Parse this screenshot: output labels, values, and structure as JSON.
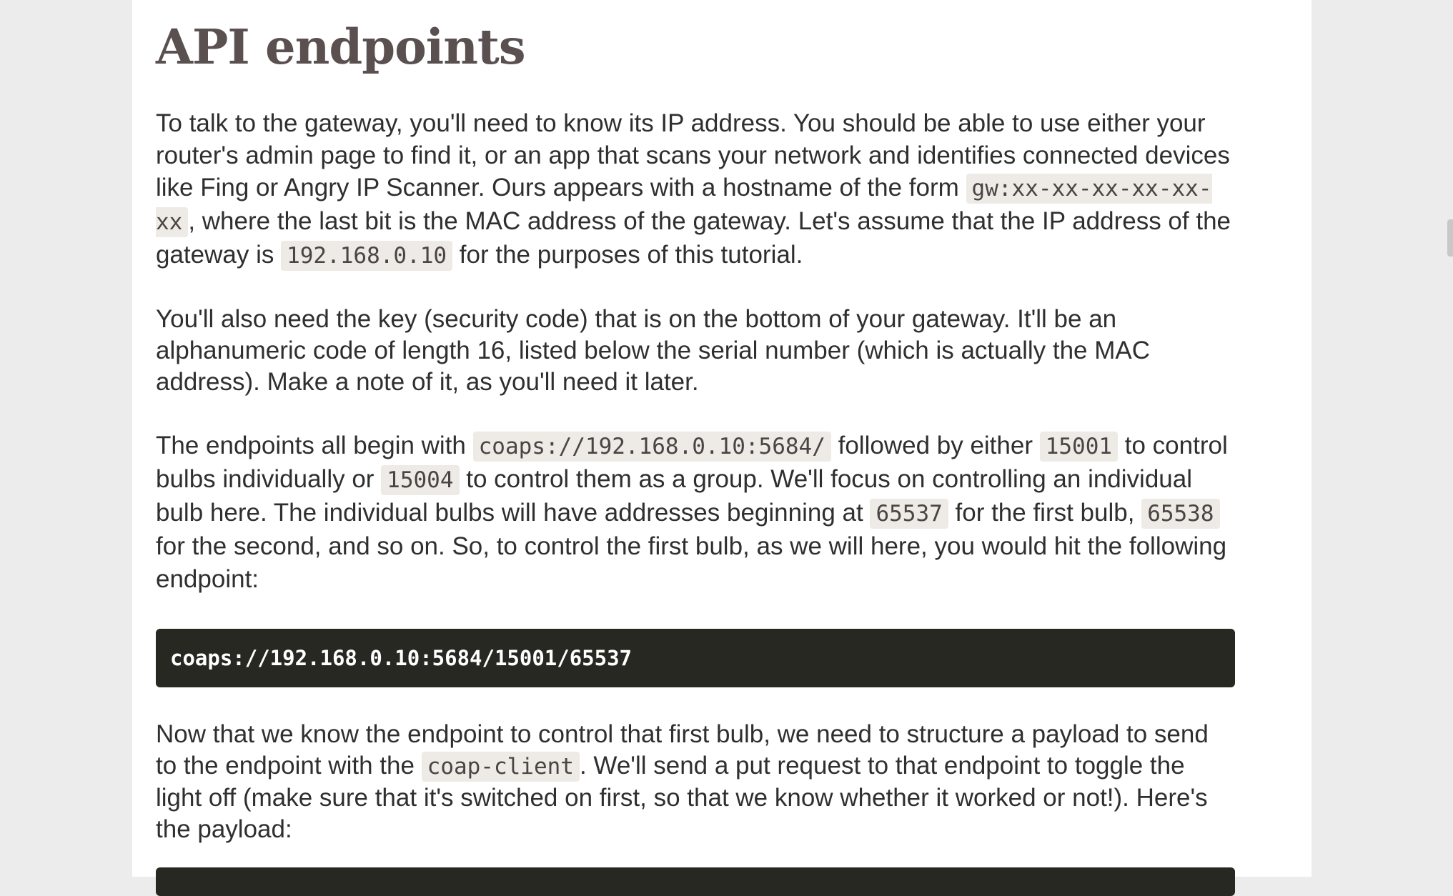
{
  "heading": "API endpoints",
  "p1": {
    "t1": "To talk to the gateway, you'll need to know its IP address. You should be able to use either your router's admin page to find it, or an app that scans your network and identifies connected devices like Fing or Angry IP Scanner. Ours appears with a hostname of the form ",
    "c1": "gw:xx-xx-xx-xx-xx-xx",
    "t2": ", where the last bit is the MAC address of the gateway. Let's assume that the IP address of the gateway is ",
    "c2": "192.168.0.10",
    "t3": " for the purposes of this tutorial."
  },
  "p2": {
    "text": "You'll also need the key (security code) that is on the bottom of your gateway. It'll be an alphanumeric code of length 16, listed below the serial number (which is actually the MAC address). Make a note of it, as you'll need it later."
  },
  "p3": {
    "t1": "The endpoints all begin with ",
    "c1": "coaps://192.168.0.10:5684/",
    "t2": " followed by either ",
    "c2": "15001",
    "t3": " to control bulbs individually or ",
    "c3": "15004",
    "t4": " to control them as a group. We'll focus on controlling an individual bulb here. The individual bulbs will have addresses beginning at ",
    "c4": "65537",
    "t5": " for the first bulb, ",
    "c5": "65538",
    "t6": " for the second, and so on. So, to control the first bulb, as we will here, you would hit the following endpoint:"
  },
  "code_block": "coaps://192.168.0.10:5684/15001/65537",
  "p4": {
    "t1": "Now that we know the endpoint to control that first bulb, we need to structure a payload to send to the endpoint with the ",
    "c1": "coap-client",
    "t2": ". We'll send a put request to that endpoint to toggle the light off (make sure that it's switched on first, so that we know whether it worked or not!). Here's the payload:"
  }
}
